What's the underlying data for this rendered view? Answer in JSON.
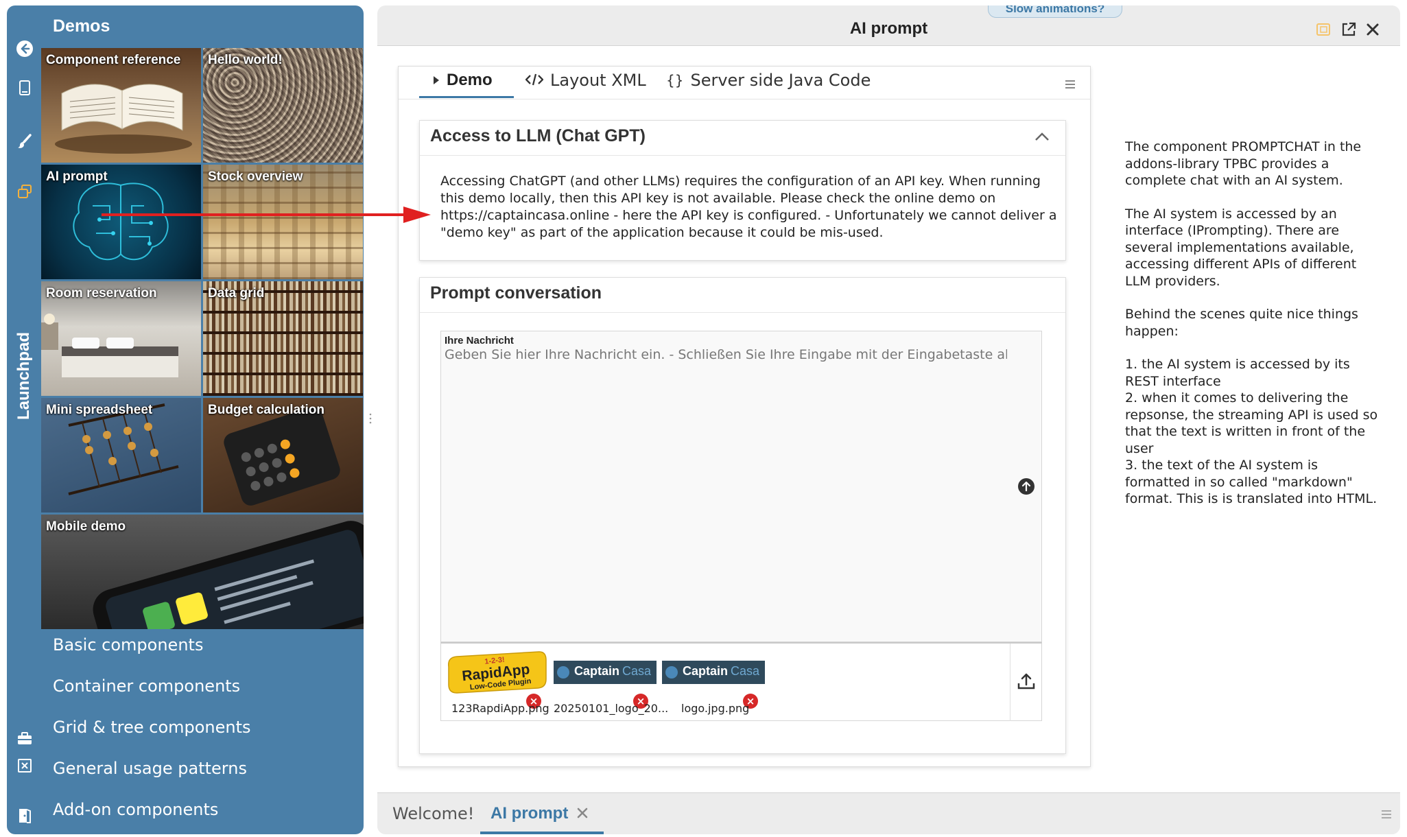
{
  "sidebar": {
    "launchpad_label": "Launchpad",
    "demos_title": "Demos",
    "tiles": [
      {
        "label": "Component reference"
      },
      {
        "label": "Hello world!"
      },
      {
        "label": "AI prompt"
      },
      {
        "label": "Stock overview"
      },
      {
        "label": "Room reservation"
      },
      {
        "label": "Data grid"
      },
      {
        "label": "Mini spreadsheet"
      },
      {
        "label": "Budget calculation"
      },
      {
        "label": "Mobile demo"
      }
    ],
    "categories": [
      {
        "label": "Basic components"
      },
      {
        "label": "Container components"
      },
      {
        "label": "Grid & tree components"
      },
      {
        "label": "General usage patterns"
      },
      {
        "label": "Add-on components"
      }
    ]
  },
  "window": {
    "title": "AI prompt",
    "slow_animations": "Slow animations?"
  },
  "demo_tabs": [
    {
      "label": "Demo",
      "icon": "caret-right-icon"
    },
    {
      "label": "Layout XML",
      "icon": "code-icon"
    },
    {
      "label": "Server side Java Code",
      "icon": "braces-icon"
    }
  ],
  "llm_panel": {
    "title": "Access to LLM (Chat GPT)",
    "text": "Accessing ChatGPT (and other LLMs) requires the configuration of an API key. When running this demo locally, then this API key is not available. Please check the online demo on https://captaincasa.online - here the API key is configured. - Unfortunately we cannot deliver a \"demo key\" as part of the application because it could be mis-used."
  },
  "prompt_panel": {
    "title": "Prompt conversation",
    "input_label": "Ihre Nachricht",
    "input_placeholder": "Geben Sie hier Ihre Nachricht ein. - Schließen Sie Ihre Eingabe mit der Eingabetaste ab.",
    "attachments": [
      {
        "name": "123RapdiApp.png",
        "logo_top": "1-2-3!",
        "logo_main": "RapidApp",
        "logo_sub": "Low-Code Plugin"
      },
      {
        "name": "20250101_logo_20...",
        "logo_a": "Captain",
        "logo_b": "Casa"
      },
      {
        "name": "logo.jpg.png",
        "logo_a": "Captain",
        "logo_b": "Casa"
      }
    ]
  },
  "description": {
    "paragraphs": [
      "The component PROMPTCHAT in the addons-library TPBC provides a complete chat with an AI system.",
      "The AI system is accessed by an interface (IPrompting). There are several implementations available, accessing different APIs of different LLM providers.",
      "Behind the scenes quite nice things happen:"
    ],
    "steps": [
      "1. the AI system is accessed by its REST interface",
      "2. when it comes to delivering the repsonse, the streaming API is used so that the text is written in front of the user",
      "3. the text of the AI system is formatted in so called \"markdown\" format. This is is translated into HTML."
    ]
  },
  "bottom_tabs": [
    {
      "label": "Welcome!"
    },
    {
      "label": "AI prompt"
    }
  ],
  "colors": {
    "brand_blue": "#4a7fa8",
    "accent": "#3c78a5",
    "arrow_red": "#e02020",
    "delete_red": "#d62828"
  }
}
